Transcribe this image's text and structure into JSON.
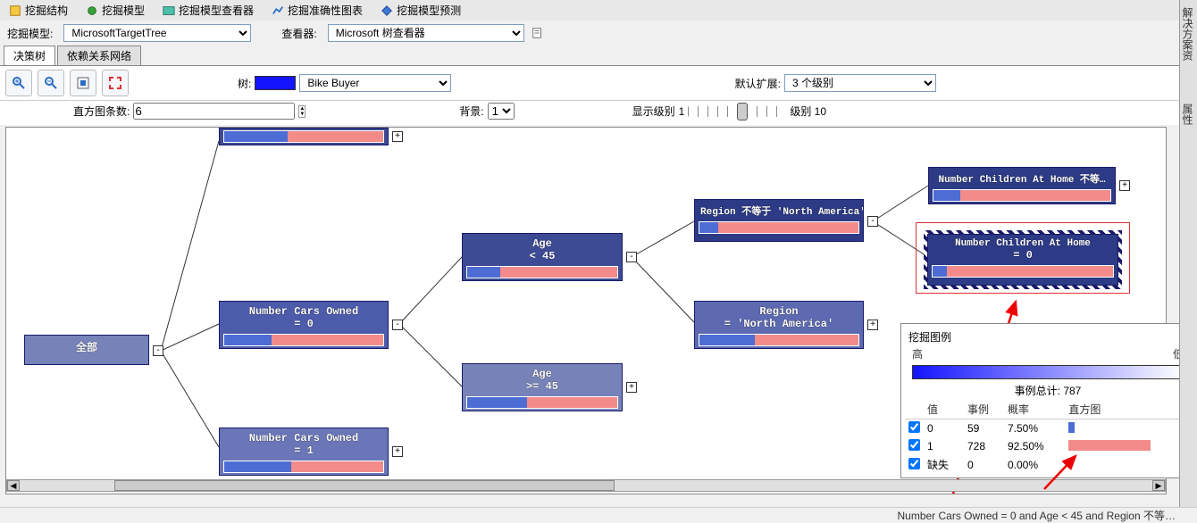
{
  "top_tabs": {
    "t1": "挖掘结构",
    "t2": "挖掘模型",
    "t3": "挖掘模型查看器",
    "t4": "挖掘准确性图表",
    "t5": "挖掘模型预测"
  },
  "model_row": {
    "model_label": "挖掘模型:",
    "model_value": "MicrosoftTargetTree",
    "viewer_label": "查看器:",
    "viewer_value": "Microsoft 树查看器"
  },
  "sub_tabs": {
    "a": "决策树",
    "b": "依赖关系网络"
  },
  "toolbar": {
    "tree_label": "树:",
    "tree_value": "Bike Buyer",
    "expand_label": "默认扩展:",
    "expand_value": "3 个级别",
    "hist_label": "直方图条数:",
    "hist_value": "6",
    "bg_label": "背景:",
    "bg_value": "1",
    "level_label": "显示级别",
    "level_min": "1",
    "level_max": "级别 10"
  },
  "nodes": {
    "root": "全部",
    "nco0_a": "Number Cars Owned",
    "nco0_b": "= 0",
    "nco1_a": "Number Cars Owned",
    "nco1_b": "= 1",
    "age_lt_a": "Age",
    "age_lt_b": "< 45",
    "age_ge_a": "Age",
    "age_ge_b": ">= 45",
    "reg_ne": "Region 不等于 'North America'",
    "reg_eq_a": "Region",
    "reg_eq_b": "= 'North America'",
    "nch_ne": "Number Children At Home 不等…",
    "nch0_a": "Number Children At Home",
    "nch0_b": "= 0"
  },
  "legend": {
    "title": "挖掘图例",
    "hi": "高",
    "lo": "低",
    "total_label": "事例总计:",
    "total_value": "787",
    "col_value": "值",
    "col_cases": "事例",
    "col_prob": "概率",
    "col_hist": "直方图",
    "rows": [
      {
        "v": "0",
        "c": "59",
        "p": "7.50%",
        "w": 7,
        "color": "#4d6cd4"
      },
      {
        "v": "1",
        "c": "728",
        "p": "92.50%",
        "w": 92,
        "color": "#f38b8b"
      },
      {
        "v": "缺失",
        "c": "0",
        "p": "0.00%",
        "w": 0,
        "color": "#ccc"
      }
    ]
  },
  "dock": {
    "a": "解决方案资",
    "b": "属性"
  },
  "status": "Number Cars Owned = 0 and Age < 45 and Region 不等…"
}
